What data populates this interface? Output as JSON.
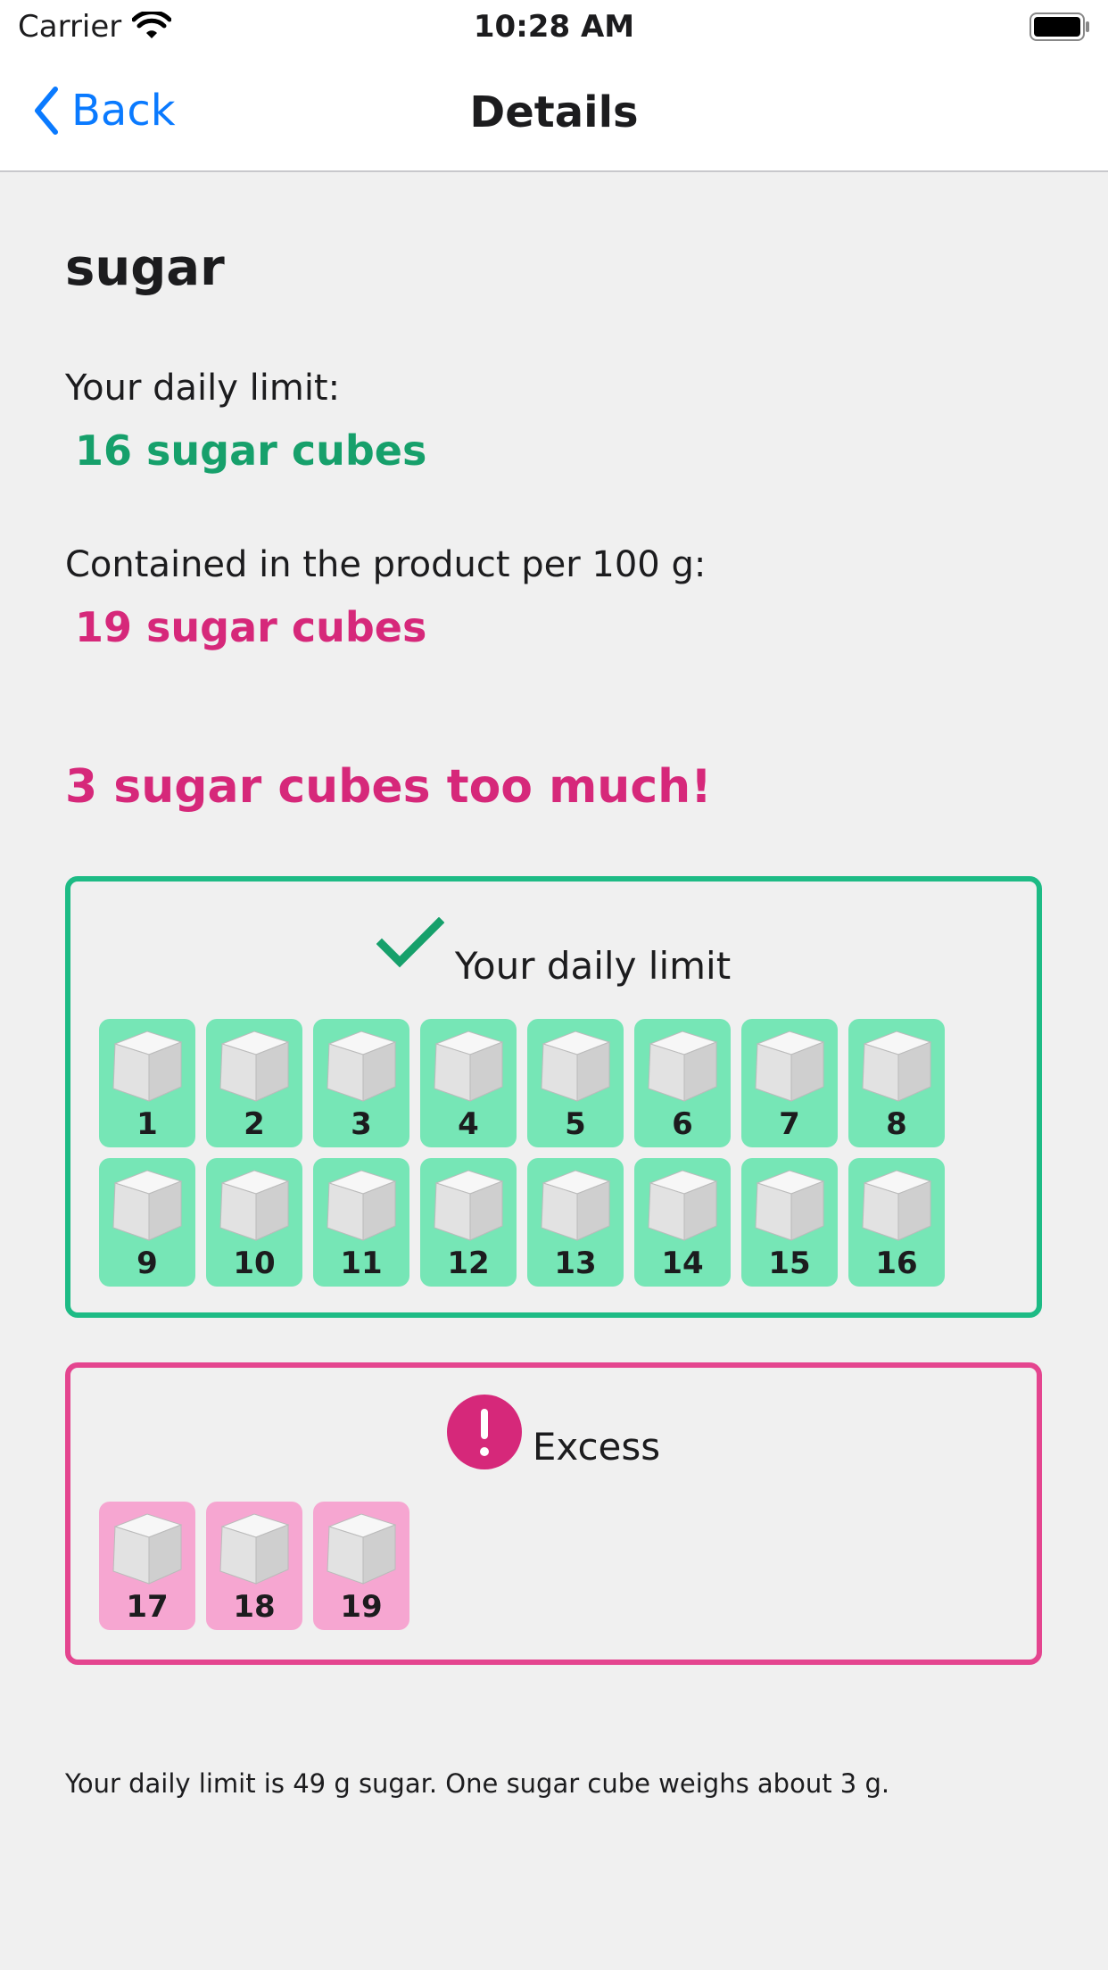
{
  "status_bar": {
    "carrier": "Carrier",
    "time": "10:28 AM"
  },
  "nav": {
    "back_label": "Back",
    "title": "Details"
  },
  "product": {
    "name": "sugar"
  },
  "limit": {
    "label": "Your daily limit:",
    "value": "16 sugar cubes"
  },
  "contained": {
    "label": "Contained in the product per 100 g:",
    "value": "19 sugar cubes"
  },
  "headline": "3 sugar cubes too much!",
  "daily_box": {
    "title": "Your daily limit",
    "cubes": [
      "1",
      "2",
      "3",
      "4",
      "5",
      "6",
      "7",
      "8",
      "9",
      "10",
      "11",
      "12",
      "13",
      "14",
      "15",
      "16"
    ]
  },
  "excess_box": {
    "title": "Excess",
    "cubes": [
      "17",
      "18",
      "19"
    ]
  },
  "footer": "Your daily limit is 49 g sugar. One sugar cube weighs about 3 g.",
  "colors": {
    "accent_blue": "#0a7aff",
    "ok_green": "#16a06b",
    "warn_pink": "#d6287a",
    "cube_green_bg": "#76e6b6",
    "cube_pink_bg": "#f6a6d1"
  }
}
